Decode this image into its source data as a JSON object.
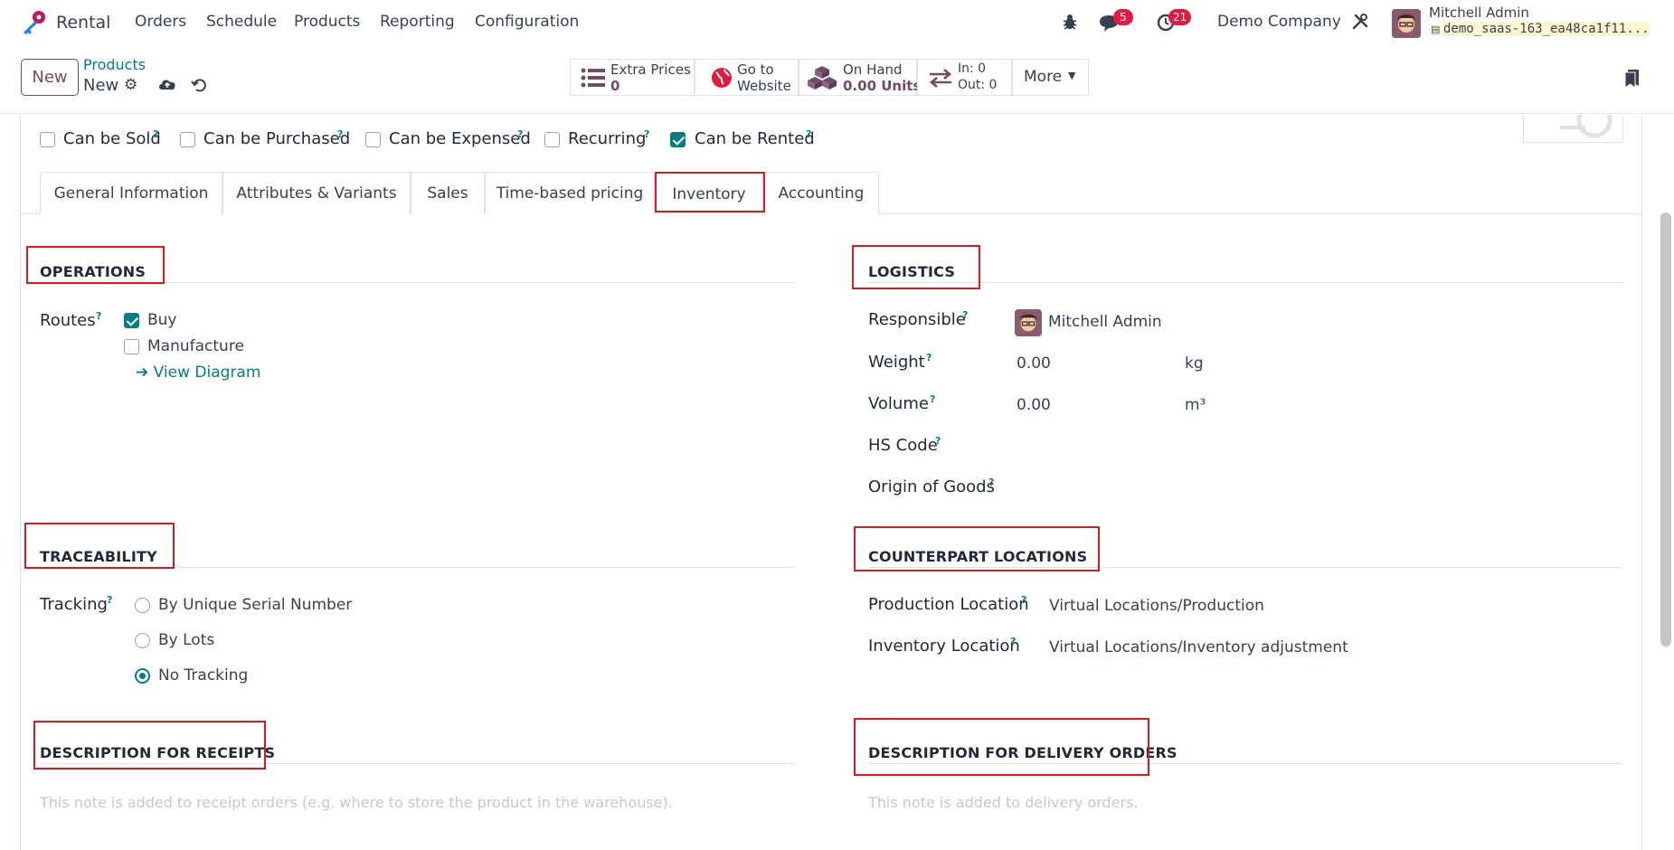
{
  "app": {
    "name": "Rental"
  },
  "nav": {
    "items": [
      "Orders",
      "Schedule",
      "Products",
      "Reporting",
      "Configuration"
    ]
  },
  "systray": {
    "messages_count": "5",
    "activities_count": "21",
    "company": "Demo Company",
    "user_name": "Mitchell Admin",
    "db_name": "demo_saas-163_ea48ca1f11..."
  },
  "control": {
    "new_label": "New",
    "breadcrumb_parent": "Products",
    "breadcrumb_current": "New"
  },
  "stats": {
    "extra_prices_label": "Extra Prices",
    "extra_prices_value": "0",
    "website_l1": "Go to",
    "website_l2": "Website",
    "on_hand_label": "On Hand",
    "on_hand_value": "0.00 Units",
    "in_label": "In: 0",
    "out_label": "Out: 0",
    "more_label": "More"
  },
  "checkboxes": [
    {
      "label": "Can be Sold",
      "checked": false
    },
    {
      "label": "Can be Purchased",
      "checked": false
    },
    {
      "label": "Can be Expensed",
      "checked": false
    },
    {
      "label": "Recurring",
      "checked": false
    },
    {
      "label": "Can be Rented",
      "checked": true
    }
  ],
  "tabs": [
    "General Information",
    "Attributes & Variants",
    "Sales",
    "Time-based pricing",
    "Inventory",
    "Accounting"
  ],
  "active_tab": "Inventory",
  "operations": {
    "title": "OPERATIONS",
    "routes_label": "Routes",
    "routes": [
      {
        "label": "Buy",
        "checked": true
      },
      {
        "label": "Manufacture",
        "checked": false
      }
    ],
    "view_diagram": "➔ View Diagram"
  },
  "logistics": {
    "title": "LOGISTICS",
    "responsible_label": "Responsible",
    "responsible_value": "Mitchell Admin",
    "weight_label": "Weight",
    "weight_value": "0.00",
    "weight_unit": "kg",
    "volume_label": "Volume",
    "volume_value": "0.00",
    "volume_unit": "m³",
    "hs_code_label": "HS Code",
    "origin_label": "Origin of Goods"
  },
  "traceability": {
    "title": "TRACEABILITY",
    "tracking_label": "Tracking",
    "options": [
      {
        "label": "By Unique Serial Number",
        "selected": false
      },
      {
        "label": "By Lots",
        "selected": false
      },
      {
        "label": "No Tracking",
        "selected": true
      }
    ]
  },
  "counterpart": {
    "title": "COUNTERPART LOCATIONS",
    "production_label": "Production Location",
    "production_value": "Virtual Locations/Production",
    "inventory_label": "Inventory Location",
    "inventory_value": "Virtual Locations/Inventory adjustment"
  },
  "receipts": {
    "title": "DESCRIPTION FOR RECEIPTS",
    "placeholder": "This note is added to receipt orders (e.g. where to store the product in the warehouse)."
  },
  "delivery": {
    "title": "DESCRIPTION FOR DELIVERY ORDERS",
    "placeholder": "This note is added to delivery orders."
  },
  "colors": {
    "brand": "#714b67",
    "accent": "#017e84",
    "highlight": "#e0171e",
    "badge": "#e3193e"
  }
}
